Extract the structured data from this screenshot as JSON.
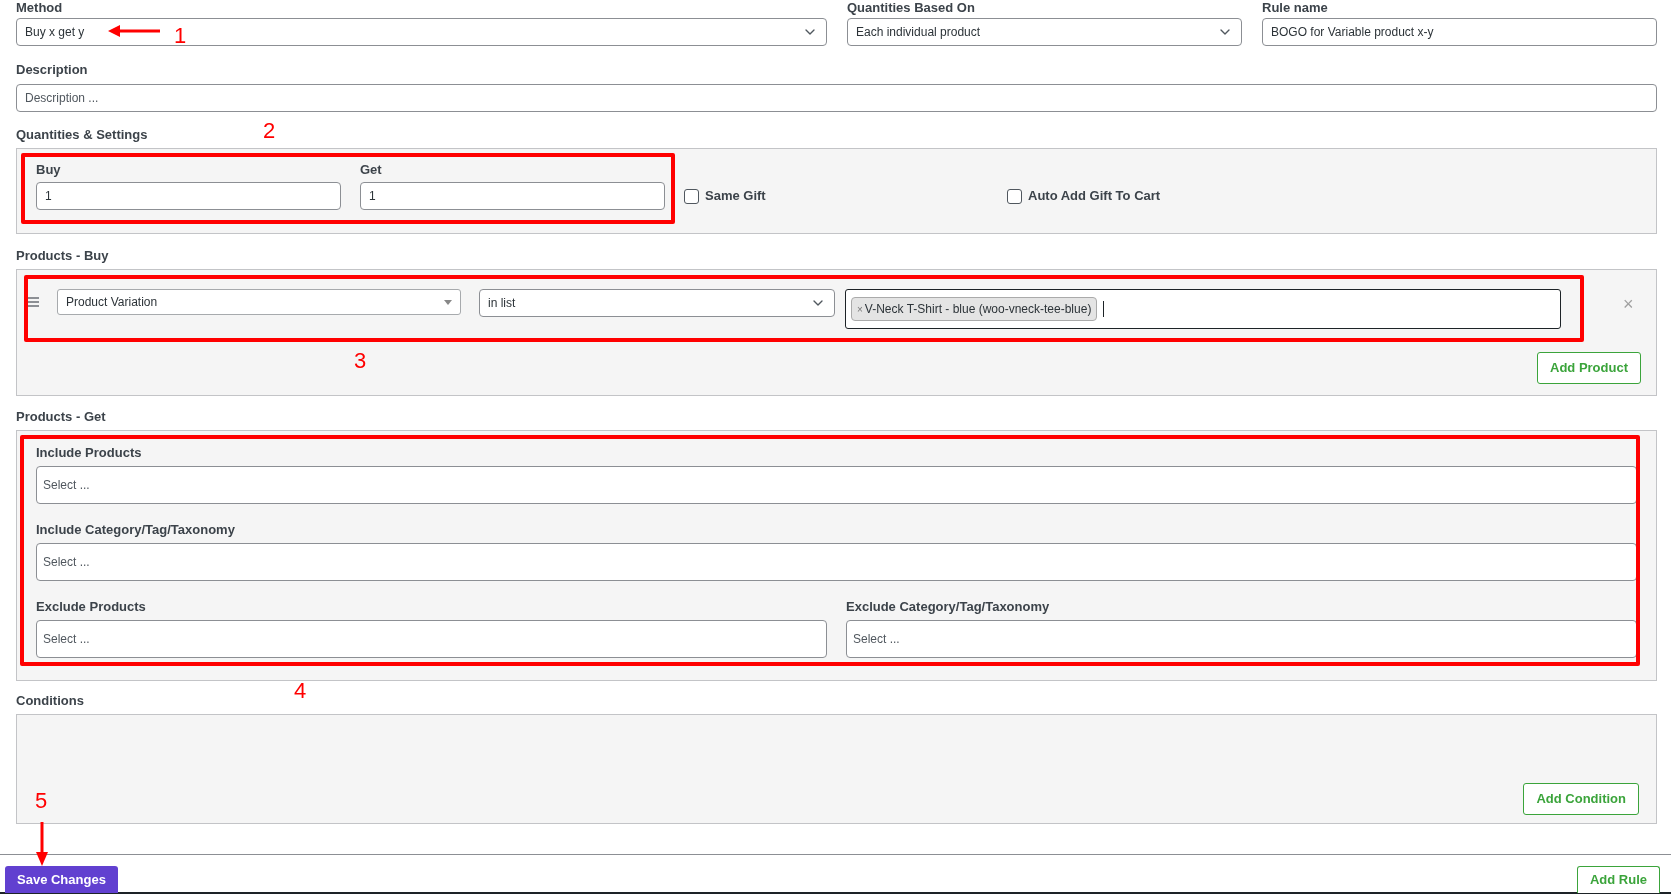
{
  "top_fields": [
    {
      "label": "Method",
      "kind": "select",
      "value": "Buy x get y",
      "annotation": {
        "number": "1",
        "kind": "arrow-left"
      }
    },
    {
      "label": "Quantities Based On",
      "kind": "select",
      "value": "Each individual product"
    },
    {
      "label": "Rule name",
      "kind": "text",
      "value": "BOGO for Variable product x-y"
    }
  ],
  "description": {
    "label": "Description",
    "placeholder": "Description ..."
  },
  "quantities": {
    "title": "Quantities & Settings",
    "annotation": {
      "number": "2",
      "kind": "box"
    },
    "buy": {
      "label": "Buy",
      "value": "1"
    },
    "get": {
      "label": "Get",
      "value": "1"
    },
    "options": [
      {
        "label": "Same Gift",
        "checked": false
      },
      {
        "label": "Auto Add Gift To Cart",
        "checked": false
      }
    ]
  },
  "products_buy": {
    "title": "Products - Buy",
    "annotation": {
      "number": "3",
      "kind": "box"
    },
    "type": "Product Variation",
    "operator": "in list",
    "tags": [
      "V-Neck T-Shirt - blue (woo-vneck-tee-blue)"
    ],
    "tag_remove": "×",
    "remove": "×",
    "add_button": "Add Product"
  },
  "products_get": {
    "title": "Products - Get",
    "annotation": {
      "number": "4",
      "kind": "box"
    },
    "fields": [
      {
        "label": "Include Products",
        "placeholder": "Select ..."
      },
      {
        "label": "Include Category/Tag/Taxonomy",
        "placeholder": "Select ..."
      },
      {
        "label": "Exclude Products",
        "placeholder": "Select ..."
      },
      {
        "label": "Exclude Category/Tag/Taxonomy",
        "placeholder": "Select ..."
      }
    ]
  },
  "conditions": {
    "title": "Conditions",
    "add_button": "Add Condition"
  },
  "footer": {
    "annotation": {
      "number": "5",
      "kind": "arrow-down"
    },
    "save_button": "Save Changes",
    "add_rule_button": "Add Rule"
  }
}
